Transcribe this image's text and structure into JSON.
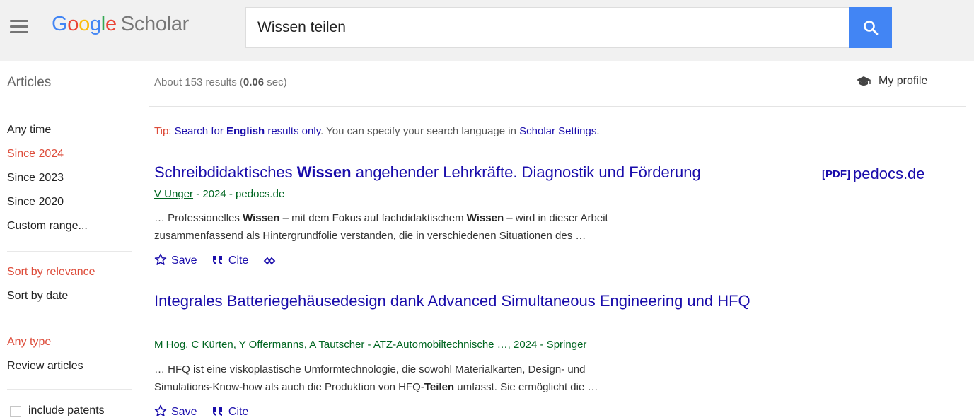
{
  "header": {
    "logo_google": "Google",
    "logo_scholar": "Scholar",
    "search_value": "Wissen teilen"
  },
  "subheader": {
    "articles_label": "Articles",
    "results_prefix": "About 153 results (",
    "results_time": "0.06",
    "results_suffix": " sec)",
    "my_profile": "My profile"
  },
  "sidebar": {
    "time_filters": [
      "Any time",
      "Since 2024",
      "Since 2023",
      "Since 2020",
      "Custom range..."
    ],
    "sort_options": [
      "Sort by relevance",
      "Sort by date"
    ],
    "type_filters": [
      "Any type",
      "Review articles"
    ],
    "include_patents": "include patents"
  },
  "tip": {
    "label": "Tip:",
    "pre": " Search for ",
    "english": "English",
    "mid": " results only",
    "post": ". You can specify your search language in ",
    "settings_link": "Scholar Settings",
    "end": "."
  },
  "results": [
    {
      "title_a": "Schreibdidaktisches ",
      "title_bold": "Wissen",
      "title_b": " angehender Lehrkräfte. Diagnostik und Förderung",
      "pdf_tag": "[PDF]",
      "pdf_source": "pedocs.de",
      "author_link": "V Unger",
      "meta": " - 2024 - pedocs.de",
      "snippet_a": "… Professionelles ",
      "snippet_b1": "Wissen",
      "snippet_c": " – mit dem Fokus auf fachdidaktischem ",
      "snippet_b2": "Wissen",
      "snippet_d": " – wird in dieser Arbeit",
      "snippet_line2": "zusammenfassend als Hintergrundfolie verstanden, die in verschiedenen Situationen des …",
      "save": "Save",
      "cite": "Cite"
    },
    {
      "title": "Integrales Batteriegehäusedesign dank Advanced Simultaneous Engineering und HFQ",
      "meta": "M Hog, C Kürten, Y Offermanns, A Tautscher - ATZ-Automobiltechnische …, 2024 - Springer",
      "snippet_line1": "… HFQ ist eine viskoplastische Umformtechnologie, die sowohl Materialkarten, Design- und",
      "snippet_a": "Simulations-Know-how als auch die Produktion von HFQ-",
      "snippet_bold": "Teilen",
      "snippet_b": " umfasst. Sie ermöglicht die …",
      "save": "Save",
      "cite": "Cite"
    }
  ],
  "colors": {
    "link": "#1a0dab",
    "active_filter": "#dd4b39",
    "authors": "#006621",
    "search_button": "#4285f4",
    "header_bg": "#f1f1f1"
  }
}
